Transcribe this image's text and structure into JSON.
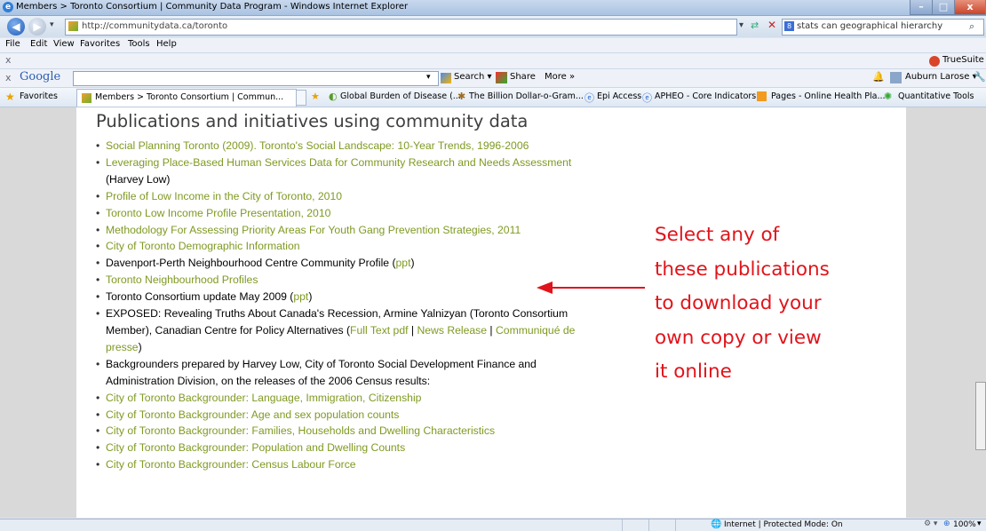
{
  "window": {
    "title": "Members > Toronto Consortium | Community Data Program - Windows Internet Explorer",
    "minimize": "–",
    "maximize": "□",
    "close": "x"
  },
  "addressbar": {
    "url": "http://communitydata.ca/toronto",
    "search_query": "stats can geographical hierarchy"
  },
  "menu": [
    "File",
    "Edit",
    "View",
    "Favorites",
    "Tools",
    "Help"
  ],
  "toolbar": {
    "close_x": "x",
    "truesuite": "TrueSuite",
    "google_label": "Google",
    "search_btn": "Search ▾",
    "share_btn": "Share",
    "more_btn": "More »",
    "user": "Auburn Larose ▾"
  },
  "favorites": {
    "label": "Favorites",
    "tab_title": "Members > Toronto Consortium | Commun...",
    "items": [
      "Global Burden of Disease (...",
      "The Billion Dollar-o-Gram...",
      "Epi Access",
      "APHEO - Core Indicators",
      "Pages - Online Health Pla...",
      "Quantitative Tools"
    ]
  },
  "content": {
    "heading": "Publications and initiatives using community data",
    "items": [
      {
        "link": "Social Planning Toronto (2009).  Toronto's Social Landscape: 10-Year Trends, 1996-2006"
      },
      {
        "link": "Leveraging Place-Based Human Services Data for Community Research and Needs Assessment",
        "text": " (Harvey Low)"
      },
      {
        "link": "Profile of Low Income in the City of Toronto, 2010"
      },
      {
        "link": "Toronto Low Income Profile Presentation, 2010"
      },
      {
        "link": "Methodology For Assessing Priority Areas For Youth Gang Prevention Strategies, 2011"
      },
      {
        "link": "City of Toronto Demographic Information"
      },
      {
        "text": "Davenport-Perth Neighbourhood Centre Community Profile (",
        "link": "ppt",
        "after": ")"
      },
      {
        "link": "Toronto Neighbourhood Profiles"
      },
      {
        "text": "Toronto Consortium update May 2009 (",
        "link": "ppt",
        "after": ")"
      },
      {
        "text": "EXPOSED: Revealing Truths About Canada's Recession, Armine Yalnizyan (Toronto Consortium Member), Canadian Centre for Policy Alternatives (",
        "link": "Full Text pdf",
        "sep1": " | ",
        "link2": "News Release",
        "sep2": " | ",
        "link3": "Communiqué de presse",
        "after": ")"
      },
      {
        "text": "Backgrounders prepared by Harvey Low, City of Toronto Social Development Finance and Administration Division, on the releases of the 2006 Census results:"
      },
      {
        "link": "City of Toronto Backgrounder: Language, Immigration, Citizenship"
      },
      {
        "link": "City of Toronto Backgrounder: Age and sex population counts"
      },
      {
        "link": "City of Toronto Backgrounder: Families, Households and Dwelling Characteristics"
      },
      {
        "link": "City of Toronto Backgrounder: Population and Dwelling Counts"
      },
      {
        "link": "City of Toronto Backgrounder: Census Labour Force"
      }
    ]
  },
  "annotation": {
    "lines": [
      "Select any of",
      "these publications",
      "to download your",
      "own copy or view",
      "it online"
    ],
    "color": "#e0141b"
  },
  "status": {
    "zone": "Internet | Protected Mode: On",
    "zoom": "100%"
  }
}
